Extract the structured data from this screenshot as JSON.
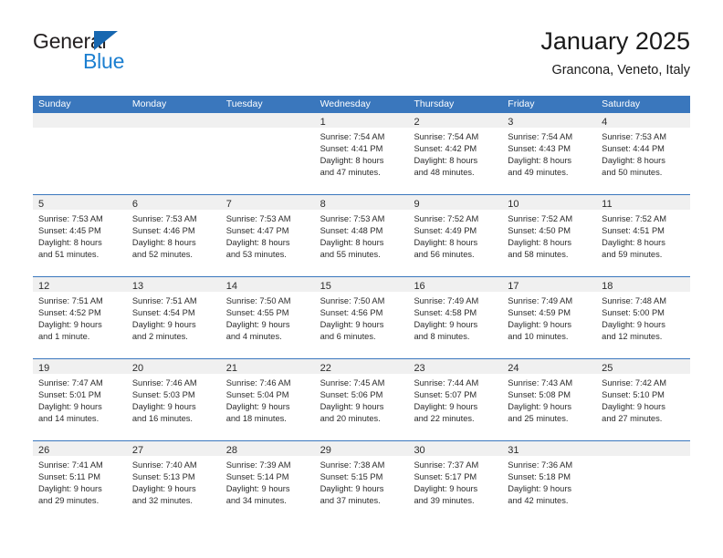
{
  "brand": {
    "name_top": "General",
    "name_bottom": "Blue",
    "flag_icon": "blue-triangle-flag",
    "color_dark": "#231f20",
    "color_blue": "#1c7fd0"
  },
  "header": {
    "title": "January 2025",
    "subtitle": "Grancona, Veneto, Italy"
  },
  "theme": {
    "header_blue": "#3a77bd",
    "day_band_gray": "#f0f0f0",
    "text": "#2b2b2b"
  },
  "weekdays": [
    "Sunday",
    "Monday",
    "Tuesday",
    "Wednesday",
    "Thursday",
    "Friday",
    "Saturday"
  ],
  "weeks": [
    [
      {
        "day": "",
        "sunrise": "",
        "sunset": "",
        "daylight_line1": "",
        "daylight_line2": ""
      },
      {
        "day": "",
        "sunrise": "",
        "sunset": "",
        "daylight_line1": "",
        "daylight_line2": ""
      },
      {
        "day": "",
        "sunrise": "",
        "sunset": "",
        "daylight_line1": "",
        "daylight_line2": ""
      },
      {
        "day": "1",
        "sunrise": "Sunrise: 7:54 AM",
        "sunset": "Sunset: 4:41 PM",
        "daylight_line1": "Daylight: 8 hours",
        "daylight_line2": "and 47 minutes."
      },
      {
        "day": "2",
        "sunrise": "Sunrise: 7:54 AM",
        "sunset": "Sunset: 4:42 PM",
        "daylight_line1": "Daylight: 8 hours",
        "daylight_line2": "and 48 minutes."
      },
      {
        "day": "3",
        "sunrise": "Sunrise: 7:54 AM",
        "sunset": "Sunset: 4:43 PM",
        "daylight_line1": "Daylight: 8 hours",
        "daylight_line2": "and 49 minutes."
      },
      {
        "day": "4",
        "sunrise": "Sunrise: 7:53 AM",
        "sunset": "Sunset: 4:44 PM",
        "daylight_line1": "Daylight: 8 hours",
        "daylight_line2": "and 50 minutes."
      }
    ],
    [
      {
        "day": "5",
        "sunrise": "Sunrise: 7:53 AM",
        "sunset": "Sunset: 4:45 PM",
        "daylight_line1": "Daylight: 8 hours",
        "daylight_line2": "and 51 minutes."
      },
      {
        "day": "6",
        "sunrise": "Sunrise: 7:53 AM",
        "sunset": "Sunset: 4:46 PM",
        "daylight_line1": "Daylight: 8 hours",
        "daylight_line2": "and 52 minutes."
      },
      {
        "day": "7",
        "sunrise": "Sunrise: 7:53 AM",
        "sunset": "Sunset: 4:47 PM",
        "daylight_line1": "Daylight: 8 hours",
        "daylight_line2": "and 53 minutes."
      },
      {
        "day": "8",
        "sunrise": "Sunrise: 7:53 AM",
        "sunset": "Sunset: 4:48 PM",
        "daylight_line1": "Daylight: 8 hours",
        "daylight_line2": "and 55 minutes."
      },
      {
        "day": "9",
        "sunrise": "Sunrise: 7:52 AM",
        "sunset": "Sunset: 4:49 PM",
        "daylight_line1": "Daylight: 8 hours",
        "daylight_line2": "and 56 minutes."
      },
      {
        "day": "10",
        "sunrise": "Sunrise: 7:52 AM",
        "sunset": "Sunset: 4:50 PM",
        "daylight_line1": "Daylight: 8 hours",
        "daylight_line2": "and 58 minutes."
      },
      {
        "day": "11",
        "sunrise": "Sunrise: 7:52 AM",
        "sunset": "Sunset: 4:51 PM",
        "daylight_line1": "Daylight: 8 hours",
        "daylight_line2": "and 59 minutes."
      }
    ],
    [
      {
        "day": "12",
        "sunrise": "Sunrise: 7:51 AM",
        "sunset": "Sunset: 4:52 PM",
        "daylight_line1": "Daylight: 9 hours",
        "daylight_line2": "and 1 minute."
      },
      {
        "day": "13",
        "sunrise": "Sunrise: 7:51 AM",
        "sunset": "Sunset: 4:54 PM",
        "daylight_line1": "Daylight: 9 hours",
        "daylight_line2": "and 2 minutes."
      },
      {
        "day": "14",
        "sunrise": "Sunrise: 7:50 AM",
        "sunset": "Sunset: 4:55 PM",
        "daylight_line1": "Daylight: 9 hours",
        "daylight_line2": "and 4 minutes."
      },
      {
        "day": "15",
        "sunrise": "Sunrise: 7:50 AM",
        "sunset": "Sunset: 4:56 PM",
        "daylight_line1": "Daylight: 9 hours",
        "daylight_line2": "and 6 minutes."
      },
      {
        "day": "16",
        "sunrise": "Sunrise: 7:49 AM",
        "sunset": "Sunset: 4:58 PM",
        "daylight_line1": "Daylight: 9 hours",
        "daylight_line2": "and 8 minutes."
      },
      {
        "day": "17",
        "sunrise": "Sunrise: 7:49 AM",
        "sunset": "Sunset: 4:59 PM",
        "daylight_line1": "Daylight: 9 hours",
        "daylight_line2": "and 10 minutes."
      },
      {
        "day": "18",
        "sunrise": "Sunrise: 7:48 AM",
        "sunset": "Sunset: 5:00 PM",
        "daylight_line1": "Daylight: 9 hours",
        "daylight_line2": "and 12 minutes."
      }
    ],
    [
      {
        "day": "19",
        "sunrise": "Sunrise: 7:47 AM",
        "sunset": "Sunset: 5:01 PM",
        "daylight_line1": "Daylight: 9 hours",
        "daylight_line2": "and 14 minutes."
      },
      {
        "day": "20",
        "sunrise": "Sunrise: 7:46 AM",
        "sunset": "Sunset: 5:03 PM",
        "daylight_line1": "Daylight: 9 hours",
        "daylight_line2": "and 16 minutes."
      },
      {
        "day": "21",
        "sunrise": "Sunrise: 7:46 AM",
        "sunset": "Sunset: 5:04 PM",
        "daylight_line1": "Daylight: 9 hours",
        "daylight_line2": "and 18 minutes."
      },
      {
        "day": "22",
        "sunrise": "Sunrise: 7:45 AM",
        "sunset": "Sunset: 5:06 PM",
        "daylight_line1": "Daylight: 9 hours",
        "daylight_line2": "and 20 minutes."
      },
      {
        "day": "23",
        "sunrise": "Sunrise: 7:44 AM",
        "sunset": "Sunset: 5:07 PM",
        "daylight_line1": "Daylight: 9 hours",
        "daylight_line2": "and 22 minutes."
      },
      {
        "day": "24",
        "sunrise": "Sunrise: 7:43 AM",
        "sunset": "Sunset: 5:08 PM",
        "daylight_line1": "Daylight: 9 hours",
        "daylight_line2": "and 25 minutes."
      },
      {
        "day": "25",
        "sunrise": "Sunrise: 7:42 AM",
        "sunset": "Sunset: 5:10 PM",
        "daylight_line1": "Daylight: 9 hours",
        "daylight_line2": "and 27 minutes."
      }
    ],
    [
      {
        "day": "26",
        "sunrise": "Sunrise: 7:41 AM",
        "sunset": "Sunset: 5:11 PM",
        "daylight_line1": "Daylight: 9 hours",
        "daylight_line2": "and 29 minutes."
      },
      {
        "day": "27",
        "sunrise": "Sunrise: 7:40 AM",
        "sunset": "Sunset: 5:13 PM",
        "daylight_line1": "Daylight: 9 hours",
        "daylight_line2": "and 32 minutes."
      },
      {
        "day": "28",
        "sunrise": "Sunrise: 7:39 AM",
        "sunset": "Sunset: 5:14 PM",
        "daylight_line1": "Daylight: 9 hours",
        "daylight_line2": "and 34 minutes."
      },
      {
        "day": "29",
        "sunrise": "Sunrise: 7:38 AM",
        "sunset": "Sunset: 5:15 PM",
        "daylight_line1": "Daylight: 9 hours",
        "daylight_line2": "and 37 minutes."
      },
      {
        "day": "30",
        "sunrise": "Sunrise: 7:37 AM",
        "sunset": "Sunset: 5:17 PM",
        "daylight_line1": "Daylight: 9 hours",
        "daylight_line2": "and 39 minutes."
      },
      {
        "day": "31",
        "sunrise": "Sunrise: 7:36 AM",
        "sunset": "Sunset: 5:18 PM",
        "daylight_line1": "Daylight: 9 hours",
        "daylight_line2": "and 42 minutes."
      },
      {
        "day": "",
        "sunrise": "",
        "sunset": "",
        "daylight_line1": "",
        "daylight_line2": ""
      }
    ]
  ]
}
